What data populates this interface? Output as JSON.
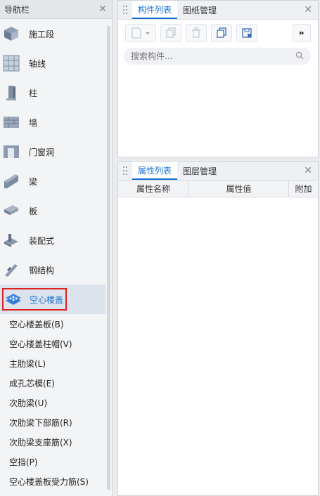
{
  "nav": {
    "title": "导航栏",
    "items": [
      {
        "label": "施工段",
        "icon": "construction-segment-icon"
      },
      {
        "label": "轴线",
        "icon": "grid-axis-icon"
      },
      {
        "label": "柱",
        "icon": "column-icon"
      },
      {
        "label": "墙",
        "icon": "wall-icon"
      },
      {
        "label": "门窗洞",
        "icon": "door-window-icon"
      },
      {
        "label": "梁",
        "icon": "beam-icon"
      },
      {
        "label": "板",
        "icon": "slab-icon"
      },
      {
        "label": "装配式",
        "icon": "prefab-icon"
      },
      {
        "label": "钢结构",
        "icon": "steel-structure-icon"
      },
      {
        "label": "空心楼盖",
        "icon": "hollow-floor-icon"
      }
    ],
    "subitems": [
      "空心楼盖板(B)",
      "空心楼盖柱帽(V)",
      "主肋梁(L)",
      "成孔芯模(E)",
      "次肋梁(U)",
      "次肋梁下部筋(R)",
      "次肋梁支座筋(X)",
      "空挡(P)",
      "空心楼盖板受力筋(S)"
    ]
  },
  "component_panel": {
    "tabs": [
      "构件列表",
      "图纸管理"
    ],
    "search_placeholder": "搜索构件..."
  },
  "property_panel": {
    "tabs": [
      "属性列表",
      "图层管理"
    ],
    "columns": [
      "属性名称",
      "属性值",
      "附加"
    ]
  },
  "colors": {
    "accent": "#1a6fd6",
    "highlight": "#e02020"
  }
}
